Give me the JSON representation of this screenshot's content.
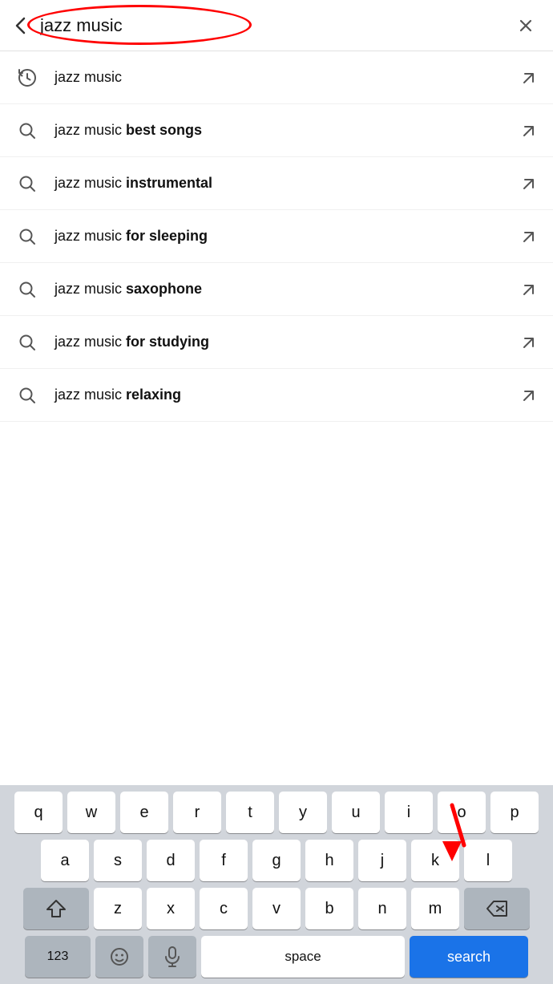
{
  "header": {
    "search_value": "jazz music",
    "close_label": "×"
  },
  "suggestions": [
    {
      "id": 1,
      "icon_type": "history",
      "text_plain": "jazz music",
      "text_bold": "",
      "full_text": "jazz music"
    },
    {
      "id": 2,
      "icon_type": "search",
      "text_plain": "jazz music ",
      "text_bold": "best songs",
      "full_text": "jazz music best songs"
    },
    {
      "id": 3,
      "icon_type": "search",
      "text_plain": "jazz music ",
      "text_bold": "instrumental",
      "full_text": "jazz music instrumental"
    },
    {
      "id": 4,
      "icon_type": "search",
      "text_plain": "jazz music ",
      "text_bold": "for sleeping",
      "full_text": "jazz music for sleeping"
    },
    {
      "id": 5,
      "icon_type": "search",
      "text_plain": "jazz music ",
      "text_bold": "saxophone",
      "full_text": "jazz music saxophone"
    },
    {
      "id": 6,
      "icon_type": "search",
      "text_plain": "jazz music ",
      "text_bold": "for studying",
      "full_text": "jazz music for studying"
    },
    {
      "id": 7,
      "icon_type": "search",
      "text_plain": "jazz music ",
      "text_bold": "relaxing",
      "full_text": "jazz music relaxing"
    }
  ],
  "keyboard": {
    "rows": [
      [
        "q",
        "w",
        "e",
        "r",
        "t",
        "y",
        "u",
        "i",
        "o",
        "p"
      ],
      [
        "a",
        "s",
        "d",
        "f",
        "g",
        "h",
        "j",
        "k",
        "l"
      ],
      [
        "z",
        "x",
        "c",
        "v",
        "b",
        "n",
        "m"
      ]
    ],
    "space_label": "space",
    "search_label": "search",
    "numbers_label": "123"
  }
}
